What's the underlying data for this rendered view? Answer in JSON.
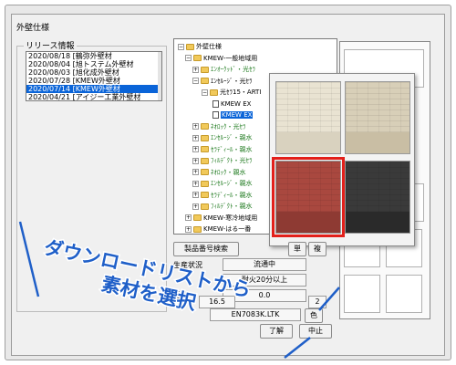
{
  "window": {
    "title": "外壁仕様"
  },
  "release_group": {
    "label": "リリース情報"
  },
  "release_list": [
    {
      "text": "2020/08/18 [鶴弥外壁材",
      "selected": false
    },
    {
      "text": "2020/08/04 [旭トステム外壁材",
      "selected": false
    },
    {
      "text": "2020/08/03 [旭化成外壁材",
      "selected": false
    },
    {
      "text": "2020/07/28 [KMEW外壁材",
      "selected": false
    },
    {
      "text": "2020/07/14 [KMEW外壁材",
      "selected": true
    },
    {
      "text": "2020/04/21 [アイジー工業外壁材",
      "selected": false
    }
  ],
  "tree": [
    {
      "text": "外壁仕様",
      "exp": "−",
      "icon": "folder"
    },
    {
      "text": "KMEW-一般地域用",
      "exp": "−",
      "icon": "folder"
    },
    {
      "text": "ｴﾝｵｰｸｯﾄﾞ・光ｾﾗ",
      "exp": "+",
      "icon": "folder",
      "green": true
    },
    {
      "text": "ｴﾝｾﾙｰｼﾞ・光ｾﾗ",
      "exp": "−",
      "icon": "folder"
    },
    {
      "text": "光ｾﾗ15・ARTI",
      "exp": "−",
      "icon": "folder"
    },
    {
      "text": "KMEW EX",
      "exp": "",
      "icon": "doc"
    },
    {
      "text": "KMEW EX",
      "exp": "",
      "icon": "doc",
      "selected": true
    },
    {
      "text": "ﾈｵﾛｯｸ・光ｾﾗ",
      "exp": "+",
      "icon": "folder",
      "green": true
    },
    {
      "text": "ｴﾝｾﾙｰｼﾞ・親水",
      "exp": "+",
      "icon": "folder",
      "green": true
    },
    {
      "text": "ｾﾗﾃﾞｨｰﾙ・親水",
      "exp": "+",
      "icon": "folder",
      "green": true
    },
    {
      "text": "ﾌｨﾙﾃﾞｸﾄ・光ｾﾗ",
      "exp": "+",
      "icon": "folder",
      "green": true
    },
    {
      "text": "ﾈｵﾛｯｸ・親水",
      "exp": "+",
      "icon": "folder",
      "green": true
    },
    {
      "text": "ｴﾝｾﾙｰｼﾞ・親水",
      "exp": "+",
      "icon": "folder",
      "green": true
    },
    {
      "text": "ｾﾗﾃﾞｨｰﾙ・親水",
      "exp": "+",
      "icon": "folder",
      "green": true
    },
    {
      "text": "ﾌｨﾙﾃﾞｸﾄ・親水",
      "exp": "+",
      "icon": "folder",
      "green": true
    },
    {
      "text": "KMEW-寒冷地域用",
      "exp": "+",
      "icon": "folder"
    },
    {
      "text": "KMEW-はる一番",
      "exp": "+",
      "icon": "folder"
    }
  ],
  "swatches": [
    {
      "top": "#e9e3d2",
      "bottom": "#d9d2bf",
      "selected": false
    },
    {
      "top": "#d8cfb8",
      "bottom": "#c9bea4",
      "selected": false
    },
    {
      "top": "#a9483f",
      "bottom": "#8e3a33",
      "selected": true
    },
    {
      "top": "#3a3a3a",
      "bottom": "#2a2a2a",
      "selected": false
    }
  ],
  "buttons": {
    "product_search": "製品番号検索",
    "single": "単",
    "double": "複",
    "ok": "了解",
    "cancel": "中止",
    "color": "色"
  },
  "fields": {
    "status_label": "生産状況",
    "status_value": "流通中",
    "fire_value": "耐火20分以上",
    "weight_label": "重量",
    "weight_value": "0.0",
    "size_value": "16.5",
    "count_value": "2",
    "product_code": "EN7083K.LTK"
  },
  "callout": {
    "line1": "ダウンロードリストから",
    "line2": "素材を選択"
  }
}
